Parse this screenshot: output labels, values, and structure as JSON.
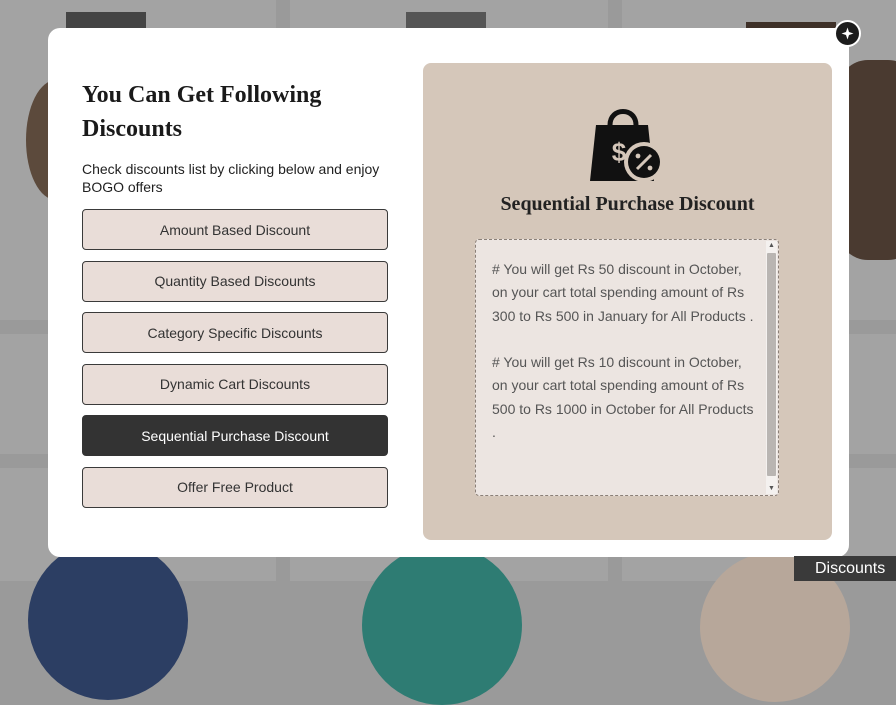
{
  "modal": {
    "title": "You Can Get Following Discounts",
    "subtitle": "Check discounts list by clicking below and enjoy BOGO offers",
    "close_icon": "close-icon",
    "buttons": [
      {
        "label": "Amount Based Discount",
        "active": false
      },
      {
        "label": "Quantity Based Discounts",
        "active": false
      },
      {
        "label": "Category Specific Discounts",
        "active": false
      },
      {
        "label": "Dynamic Cart Discounts",
        "active": false
      },
      {
        "label": "Sequential Purchase Discount",
        "active": true
      },
      {
        "label": "Offer Free Product",
        "active": false
      }
    ]
  },
  "detail": {
    "icon": "shopping-bag-discount-icon",
    "title": "Sequential Purchase Discount",
    "paragraphs": [
      "# You will get Rs 50 discount in October, on your cart total spending amount of Rs 300 to Rs 500 in January for All Products .",
      "# You will get Rs 10 discount in October, on your cart total spending amount of Rs 500 to Rs 1000 in October for All Products ."
    ]
  },
  "floating_tab": {
    "label": "Discounts"
  },
  "colors": {
    "accent_dark": "#333333",
    "button_bg": "#e9ddd8",
    "panel_bg": "#d5c7ba",
    "detail_bg": "#ece5e1"
  }
}
